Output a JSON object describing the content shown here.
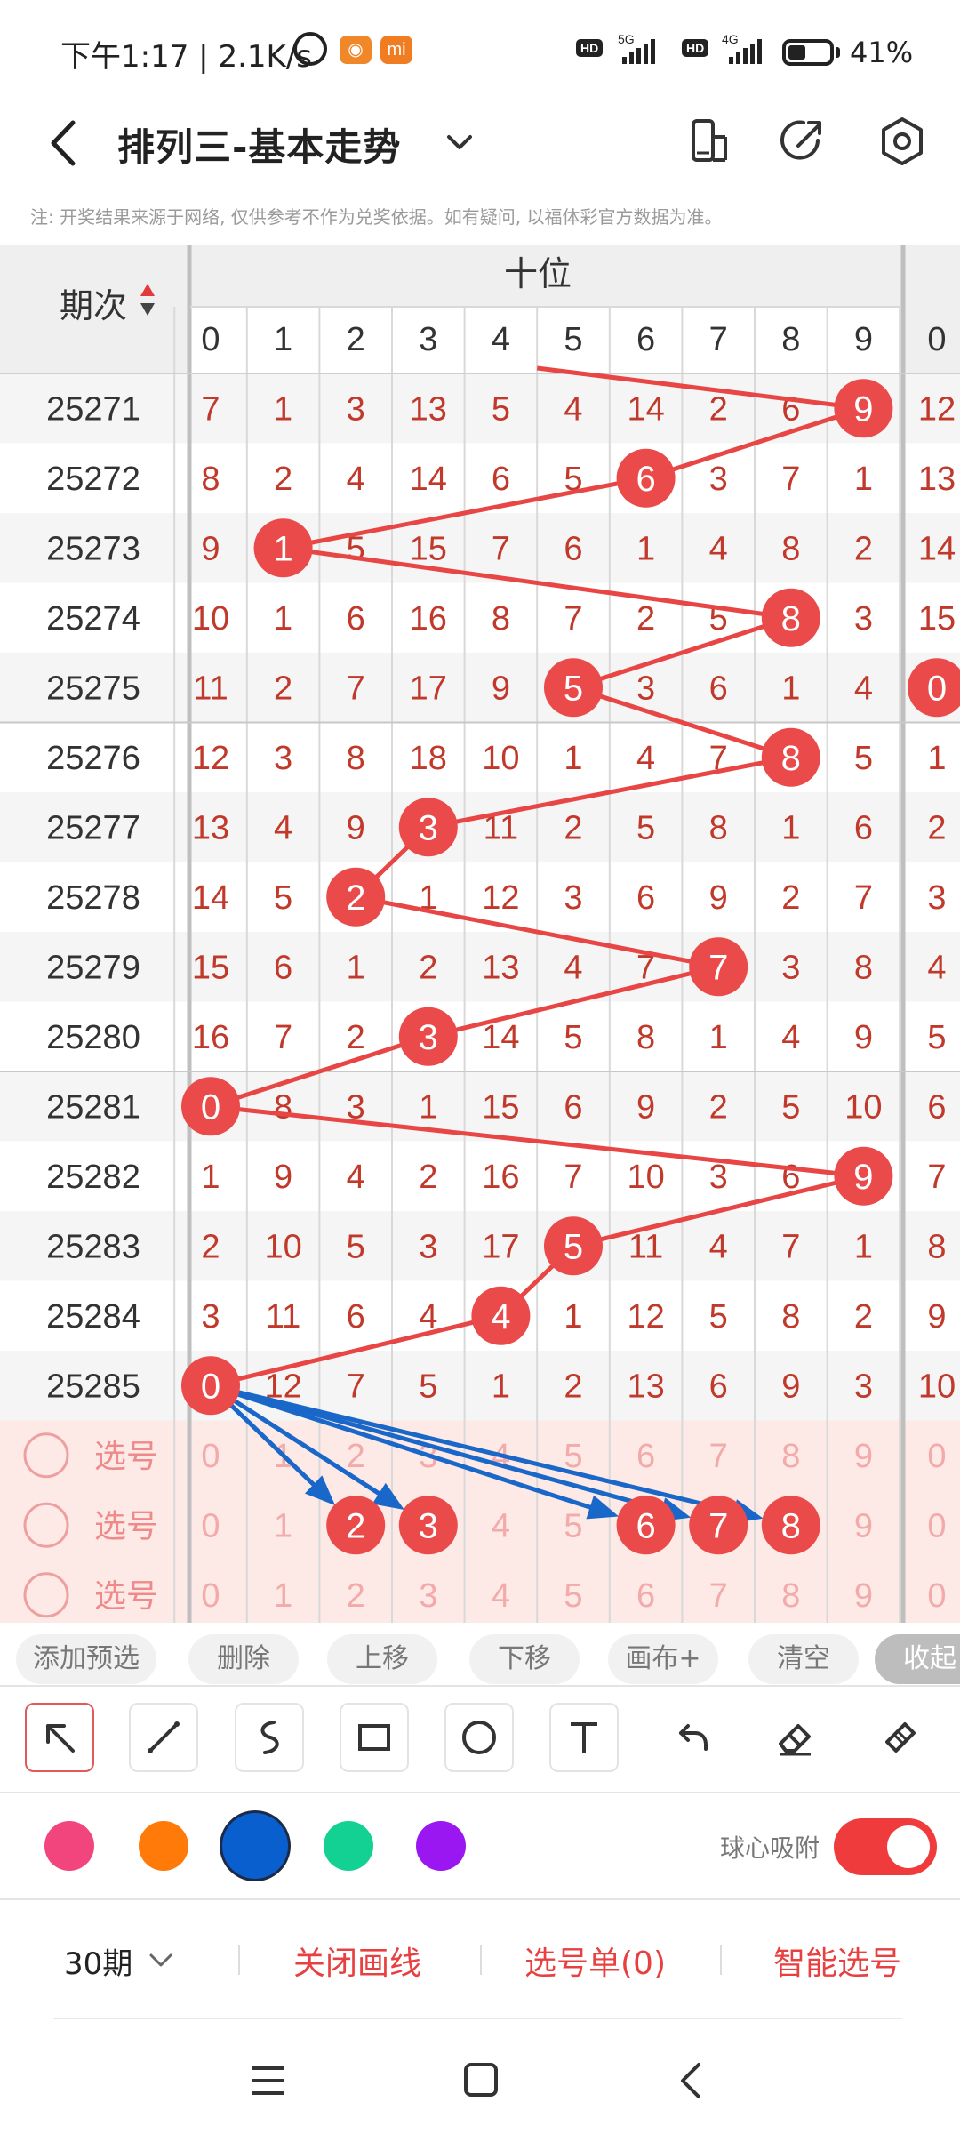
{
  "status_bar": {
    "time": "下午1:17",
    "speed": "2.1K/s",
    "app_badge": "mi",
    "hd_label": "HD",
    "gen5": "5G",
    "gen4": "4G",
    "battery_percent": "41%",
    "battery_level": 0.41
  },
  "title_bar": {
    "title": "排列三-基本走势",
    "notice": "注: 开奖结果来源于网络, 仅供参考不作为兑奖依据。如有疑问, 以福体彩官方数据为准。"
  },
  "chart": {
    "period_header": "期次",
    "section_header": "十位",
    "digit_headers": [
      "0",
      "1",
      "2",
      "3",
      "4",
      "5",
      "6",
      "7",
      "8",
      "9"
    ],
    "next_digit_header": "0",
    "colors": {
      "ball": "#ea4a4a",
      "line": "#e84545",
      "arrow": "#1967c8",
      "text": "#c0392b",
      "pick_bg": "#fde9e5",
      "pick_text": "#f3aaaa"
    },
    "rows": [
      {
        "period": "25271",
        "cells": [
          "7",
          "1",
          "3",
          "13",
          "5",
          "4",
          "14",
          "2",
          "6",
          "9"
        ],
        "hit": 9,
        "next": "12"
      },
      {
        "period": "25272",
        "cells": [
          "8",
          "2",
          "4",
          "14",
          "6",
          "5",
          "6",
          "3",
          "7",
          "1"
        ],
        "hit": 6,
        "next": "13"
      },
      {
        "period": "25273",
        "cells": [
          "9",
          "1",
          "5",
          "15",
          "7",
          "6",
          "1",
          "4",
          "8",
          "2"
        ],
        "hit": 1,
        "next": "14"
      },
      {
        "period": "25274",
        "cells": [
          "10",
          "1",
          "6",
          "16",
          "8",
          "7",
          "2",
          "5",
          "8",
          "3"
        ],
        "hit": 8,
        "next": "15"
      },
      {
        "period": "25275",
        "cells": [
          "11",
          "2",
          "7",
          "17",
          "9",
          "5",
          "3",
          "6",
          "1",
          "4"
        ],
        "hit": 5,
        "next": "0",
        "next_hit": true
      },
      {
        "period": "25276",
        "cells": [
          "12",
          "3",
          "8",
          "18",
          "10",
          "1",
          "4",
          "7",
          "8",
          "5"
        ],
        "hit": 8,
        "next": "1"
      },
      {
        "period": "25277",
        "cells": [
          "13",
          "4",
          "9",
          "3",
          "11",
          "2",
          "5",
          "8",
          "1",
          "6"
        ],
        "hit": 3,
        "next": "2"
      },
      {
        "period": "25278",
        "cells": [
          "14",
          "5",
          "2",
          "1",
          "12",
          "3",
          "6",
          "9",
          "2",
          "7"
        ],
        "hit": 2,
        "next": "3"
      },
      {
        "period": "25279",
        "cells": [
          "15",
          "6",
          "1",
          "2",
          "13",
          "4",
          "7",
          "7",
          "3",
          "8"
        ],
        "hit": 7,
        "next": "4"
      },
      {
        "period": "25280",
        "cells": [
          "16",
          "7",
          "2",
          "3",
          "14",
          "5",
          "8",
          "1",
          "4",
          "9"
        ],
        "hit": 3,
        "next": "5"
      },
      {
        "period": "25281",
        "cells": [
          "0",
          "8",
          "3",
          "1",
          "15",
          "6",
          "9",
          "2",
          "5",
          "10"
        ],
        "hit": 0,
        "next": "6"
      },
      {
        "period": "25282",
        "cells": [
          "1",
          "9",
          "4",
          "2",
          "16",
          "7",
          "10",
          "3",
          "6",
          "9"
        ],
        "hit": 9,
        "next": "7"
      },
      {
        "period": "25283",
        "cells": [
          "2",
          "10",
          "5",
          "3",
          "17",
          "5",
          "11",
          "4",
          "7",
          "1"
        ],
        "hit": 5,
        "next": "8"
      },
      {
        "period": "25284",
        "cells": [
          "3",
          "11",
          "6",
          "4",
          "4",
          "1",
          "12",
          "5",
          "8",
          "2"
        ],
        "hit": 4,
        "next": "9"
      },
      {
        "period": "25285",
        "cells": [
          "0",
          "12",
          "7",
          "5",
          "1",
          "2",
          "13",
          "6",
          "9",
          "3"
        ],
        "hit": 0,
        "next": "10"
      }
    ],
    "pick_rows": [
      {
        "label": "选号",
        "cells": [
          "0",
          "1",
          "2",
          "3",
          "4",
          "5",
          "6",
          "7",
          "8",
          "9"
        ],
        "selected": [],
        "next": "0"
      },
      {
        "label": "选号",
        "cells": [
          "0",
          "1",
          "2",
          "3",
          "4",
          "5",
          "6",
          "7",
          "8",
          "9"
        ],
        "selected": [
          2,
          3,
          6,
          7,
          8
        ],
        "next": "0"
      },
      {
        "label": "选号",
        "cells": [
          "0",
          "1",
          "2",
          "3",
          "4",
          "5",
          "6",
          "7",
          "8",
          "9"
        ],
        "selected": [],
        "next": "0"
      }
    ]
  },
  "actions": {
    "add_preselect": "添加预选",
    "delete": "删除",
    "move_up": "上移",
    "move_down": "下移",
    "canvas_plus": "画布+",
    "clear": "清空",
    "collapse": "收起"
  },
  "tools": {
    "icons": [
      "pointer-tool",
      "line-tool",
      "freehand-tool",
      "rectangle-tool",
      "circle-tool",
      "text-tool",
      "undo-tool",
      "eraser-tool",
      "clear-brush-tool"
    ],
    "active": "pointer-tool"
  },
  "palette": {
    "colors": [
      "#f2457d",
      "#ff7a08",
      "#0a5fcf",
      "#13d192",
      "#9b17f2"
    ],
    "selected": "#0a5fcf",
    "snap_label": "球心吸附",
    "snap_on": true
  },
  "bottom_menu": {
    "period_select": "30期",
    "close_lines": "关闭画线",
    "pick_list": "选号单(0)",
    "smart_pick": "智能选号"
  }
}
